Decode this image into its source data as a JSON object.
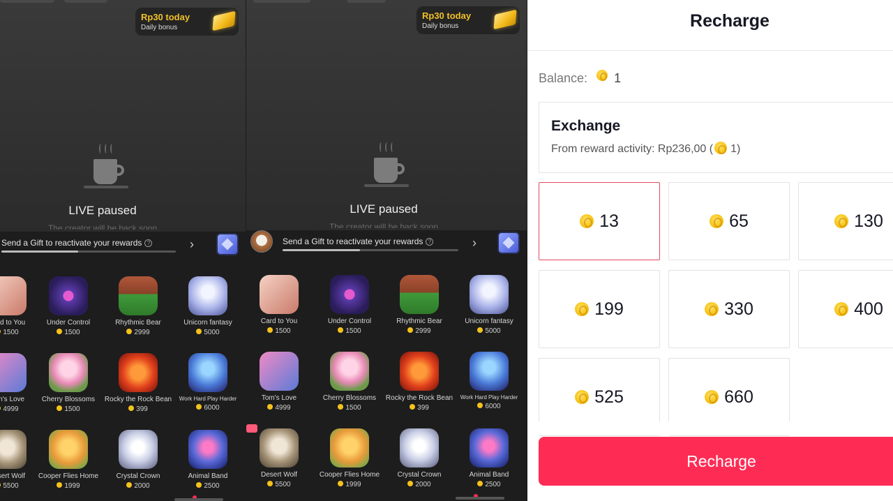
{
  "phone_left": {
    "bonus_amount": "Rp30 today",
    "bonus_label": "Daily bonus",
    "status": "LIVE paused",
    "status_sub": "The creator will be back soon",
    "gift_prompt": "Send a Gift to reactivate your rewards",
    "gifts": [
      {
        "name": "Card to You",
        "price": "1500"
      },
      {
        "name": "Under Control",
        "price": "1500"
      },
      {
        "name": "Rhythmic Bear",
        "price": "2999"
      },
      {
        "name": "Unicorn fantasy",
        "price": "5000"
      },
      {
        "name": "Tom's Love",
        "price": "4999"
      },
      {
        "name": "Cherry Blossoms",
        "price": "1500"
      },
      {
        "name": "Rocky the Rock Bean",
        "price": "399"
      },
      {
        "name": "Work Hard Play Harder",
        "price": "6000"
      },
      {
        "name": "Desert Wolf",
        "price": "5500"
      },
      {
        "name": "Cooper Flies Home",
        "price": "1999"
      },
      {
        "name": "Crystal Crown",
        "price": "2000"
      },
      {
        "name": "Animal Band",
        "price": "2500"
      }
    ]
  },
  "phone_right": {
    "bonus_amount": "Rp30 today",
    "bonus_label": "Daily bonus",
    "status": "LIVE paused",
    "status_sub": "The creator will be back soon",
    "gift_prompt": "Send a Gift to reactivate your rewards",
    "gifts": [
      {
        "name": "Card to You",
        "price": "1500"
      },
      {
        "name": "Under Control",
        "price": "1500"
      },
      {
        "name": "Rhythmic Bear",
        "price": "2999"
      },
      {
        "name": "Unicorn fantasy",
        "price": "5000"
      },
      {
        "name": "Tom's Love",
        "price": "4999"
      },
      {
        "name": "Cherry Blossoms",
        "price": "1500"
      },
      {
        "name": "Rocky the Rock Bean",
        "price": "399"
      },
      {
        "name": "Work Hard Play Harder",
        "price": "6000"
      },
      {
        "name": "Desert Wolf",
        "price": "5500"
      },
      {
        "name": "Cooper Flies Home",
        "price": "1999"
      },
      {
        "name": "Crystal Crown",
        "price": "2000"
      },
      {
        "name": "Animal Band",
        "price": "2500"
      }
    ]
  },
  "recharge": {
    "title": "Recharge",
    "balance_label": "Balance:",
    "balance_value": "1",
    "exchange_title": "Exchange",
    "exchange_sub_prefix": "From reward activity: Rp236,00 (",
    "exchange_sub_coins": "1)",
    "packages": [
      "13",
      "65",
      "130",
      "199",
      "330",
      "400",
      "525",
      "660"
    ],
    "selected_package": "13",
    "button_label": "Recharge"
  },
  "colors": {
    "accent": "#fe2c55",
    "coin": "#f7c61a",
    "selected_border": "#e24b5e"
  }
}
